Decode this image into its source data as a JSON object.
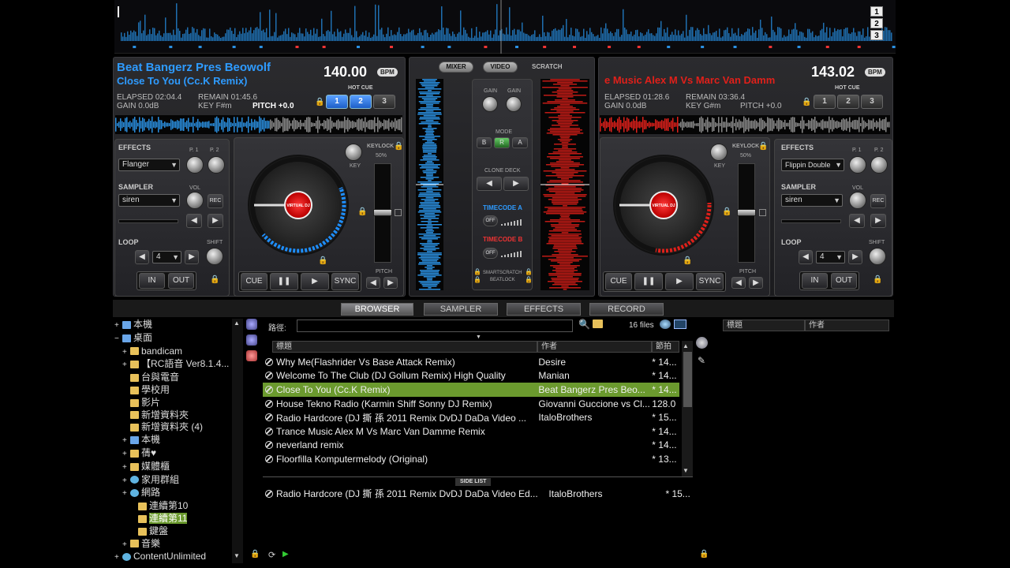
{
  "top": {
    "deck_numbers": [
      "1",
      "2",
      "3"
    ]
  },
  "left_deck": {
    "title1": "Beat Bangerz Pres Beowolf",
    "title2": "Close To You (Cc.K Remix)",
    "bpm": "140.00",
    "bpm_unit": "BPM",
    "elapsed": "ELAPSED 02:04.4",
    "remain": "REMAIN 01:45.6",
    "gain": "GAIN 0.0dB",
    "key": "KEY F#m",
    "pitch": "PITCH +0.0",
    "hotcue_label": "HOT CUE",
    "hotcues": [
      "1",
      "2",
      "3"
    ],
    "effects_label": "EFFECTS",
    "effect_value": "Flanger",
    "p1": "P. 1",
    "p2": "P. 2",
    "sampler_label": "SAMPLER",
    "sampler_value": "siren",
    "vol": "VOL",
    "rec": "REC",
    "loop_label": "LOOP",
    "loop_value": "4",
    "shift": "SHIFT",
    "in": "IN",
    "out": "OUT",
    "keylock": "KEYLOCK",
    "key_small": "KEY",
    "pct": "50%",
    "cue": "CUE",
    "sync": "SYNC",
    "pitch_lbl": "PITCH",
    "platter_brand": "VIRTUAL DJ"
  },
  "right_deck": {
    "title1": "e   Music Alex M Vs Marc Van Damm",
    "bpm": "143.02",
    "bpm_unit": "BPM",
    "elapsed": "ELAPSED 01:28.6",
    "remain": "REMAIN 03:36.4",
    "gain": "GAIN 0.0dB",
    "key": "KEY G#m",
    "pitch": "PITCH +0.0",
    "hotcue_label": "HOT CUE",
    "hotcues": [
      "1",
      "2",
      "3"
    ],
    "effects_label": "EFFECTS",
    "effect_value": "Flippin Double",
    "p1": "P. 1",
    "p2": "P. 2",
    "sampler_label": "SAMPLER",
    "sampler_value": "siren",
    "vol": "VOL",
    "rec": "REC",
    "loop_label": "LOOP",
    "loop_value": "4",
    "shift": "SHIFT",
    "in": "IN",
    "out": "OUT",
    "keylock": "KEYLOCK",
    "key_small": "KEY",
    "pct": "50%",
    "cue": "CUE",
    "sync": "SYNC",
    "pitch_lbl": "PITCH",
    "platter_brand": "VIRTUAL DJ"
  },
  "mixer": {
    "tabs": [
      "MIXER",
      "VIDEO",
      "SCRATCH"
    ],
    "gain": "GAIN",
    "mode": "MODE",
    "mode_btns": [
      "B",
      "R",
      "A"
    ],
    "clone_deck": "CLONE DECK",
    "timecode_a": "TIMECODE A",
    "timecode_b": "TIMECODE B",
    "off": "OFF",
    "smartscratch": "SMARTSCRATCH",
    "beatlock": "BEATLOCK"
  },
  "tabs": [
    "BROWSER",
    "SAMPLER",
    "EFFECTS",
    "RECORD"
  ],
  "tree": [
    {
      "label": "本機",
      "indent": 0,
      "sign": "+",
      "type": "pc"
    },
    {
      "label": "桌面",
      "indent": 0,
      "sign": "−",
      "type": "desk"
    },
    {
      "label": "bandicam",
      "indent": 1,
      "sign": "+",
      "type": "folder"
    },
    {
      "label": "【RC語音 Ver8.1.4...",
      "indent": 1,
      "sign": "+",
      "type": "folder"
    },
    {
      "label": "台與電音",
      "indent": 1,
      "sign": "",
      "type": "folder"
    },
    {
      "label": "學校用",
      "indent": 1,
      "sign": "",
      "type": "folder"
    },
    {
      "label": "影片",
      "indent": 1,
      "sign": "",
      "type": "folder"
    },
    {
      "label": "新增資料夾",
      "indent": 1,
      "sign": "",
      "type": "folder"
    },
    {
      "label": "新增資料夾 (4)",
      "indent": 1,
      "sign": "",
      "type": "folder"
    },
    {
      "label": "本機",
      "indent": 1,
      "sign": "+",
      "type": "pc"
    },
    {
      "label": "蒨♥",
      "indent": 1,
      "sign": "+",
      "type": "folder"
    },
    {
      "label": "媒體櫃",
      "indent": 1,
      "sign": "+",
      "type": "folder"
    },
    {
      "label": "家用群組",
      "indent": 1,
      "sign": "+",
      "type": "net"
    },
    {
      "label": "網路",
      "indent": 1,
      "sign": "+",
      "type": "net"
    },
    {
      "label": "連續第10",
      "indent": 2,
      "sign": "",
      "type": "folder"
    },
    {
      "label": "連續第11",
      "indent": 2,
      "sign": "",
      "type": "folder",
      "selected": true
    },
    {
      "label": "鍵盤",
      "indent": 2,
      "sign": "",
      "type": "folder"
    },
    {
      "label": "音樂",
      "indent": 1,
      "sign": "+",
      "type": "folder"
    },
    {
      "label": "ContentUnlimited",
      "indent": 0,
      "sign": "+",
      "type": "globe"
    }
  ],
  "browser": {
    "path_label": "路徑:",
    "file_count": "16 files",
    "headers": [
      "標題",
      "作者",
      "節拍"
    ],
    "rows": [
      {
        "title": "Why Me(Flashrider Vs Base Attack Remix)",
        "artist": "Desire",
        "bpm": "* 14..."
      },
      {
        "title": "Welcome To The Club (DJ Gollum Remix) High Quality",
        "artist": "Manian",
        "bpm": "* 14..."
      },
      {
        "title": "Close To You (Cc.K Remix)",
        "artist": "Beat Bangerz Pres Beo...",
        "bpm": "* 14...",
        "selected": true
      },
      {
        "title": "House Tekno Radio (Karmin Shiff  Sonny DJ Remix)",
        "artist": "Giovanni Guccione vs Cl...",
        "bpm": "128.0"
      },
      {
        "title": "Radio Hardcore (DJ 撕    孫 2011 Remix  DvDJ DaDa Video ...",
        "artist": "ItaloBrothers",
        "bpm": "* 15..."
      },
      {
        "title": "Trance   Music Alex M Vs Marc Van Damme Remix",
        "artist": "",
        "bpm": "* 14..."
      },
      {
        "title": "neverland remix",
        "artist": "",
        "bpm": "* 14..."
      },
      {
        "title": "Floorfilla   Komputermelody (Original)",
        "artist": "",
        "bpm": "* 13..."
      }
    ],
    "side_list_label": "SIDE LIST",
    "side_row": {
      "title": "Radio Hardcore (DJ 撕    孫 2011 Remix  DvDJ DaDa Video Ed...",
      "artist": "ItaloBrothers",
      "bpm": "* 15..."
    }
  },
  "right_panel": {
    "headers": [
      "標題",
      "作者"
    ]
  }
}
